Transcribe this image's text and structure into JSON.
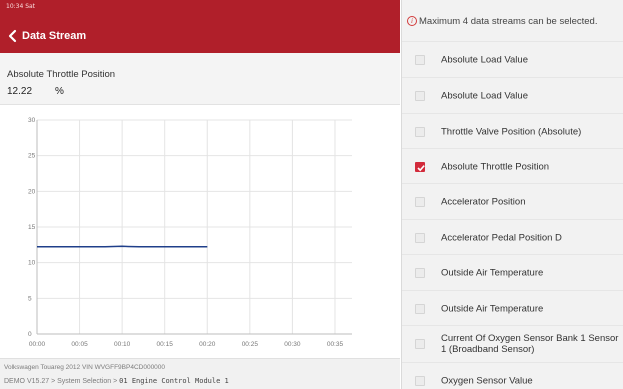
{
  "status_bar": {
    "time": "10:34 Sat"
  },
  "header": {
    "title": "Data Stream"
  },
  "current_pid": {
    "name": "Absolute Throttle Position",
    "value": "12.22",
    "unit": "%"
  },
  "chart_data": {
    "type": "line",
    "x_ticks": [
      "00:00",
      "00:05",
      "00:10",
      "00:15",
      "00:20",
      "00:25",
      "00:30",
      "00:35"
    ],
    "y_ticks": [
      "0",
      "5",
      "10",
      "15",
      "20",
      "25",
      "30"
    ],
    "ylim": [
      0,
      30
    ],
    "xlim": [
      0,
      37
    ],
    "grid": true,
    "series": [
      {
        "color": "#1f3f8a",
        "x": [
          0,
          2,
          4,
          6,
          8,
          10,
          12,
          14,
          16,
          18,
          20
        ],
        "y": [
          12.22,
          12.22,
          12.22,
          12.22,
          12.22,
          12.3,
          12.22,
          12.22,
          12.22,
          12.22,
          12.22
        ]
      }
    ]
  },
  "footer": {
    "vehicle": "Volkswagen  Touareg  2012  VIN  WVGFF9BP4CD000000",
    "path_prefix": "DEMO V15.27 > System Selection > ",
    "path_module": "01 Engine Control Module 1"
  },
  "sidebar": {
    "notice": "Maximum 4 data streams can be selected.",
    "items": [
      {
        "label": "Absolute Load Value",
        "checked": false
      },
      {
        "label": "Absolute Load Value",
        "checked": false
      },
      {
        "label": "Throttle Valve Position (Absolute)",
        "checked": false
      },
      {
        "label": "Absolute Throttle Position",
        "checked": true
      },
      {
        "label": "Accelerator Position",
        "checked": false
      },
      {
        "label": "Accelerator Pedal Position D",
        "checked": false
      },
      {
        "label": "Outside Air Temperature",
        "checked": false
      },
      {
        "label": "Outside Air Temperature",
        "checked": false
      },
      {
        "label": "Current Of Oxygen Sensor Bank 1 Sensor 1 (Broadband Sensor)",
        "checked": false
      },
      {
        "label": "Oxygen Sensor Value",
        "checked": false
      }
    ]
  },
  "colors": {
    "header_red": "#b01f2a",
    "check_red": "#d22b3b",
    "line_blue": "#1f3f8a",
    "grid": "#e4e4e4"
  }
}
